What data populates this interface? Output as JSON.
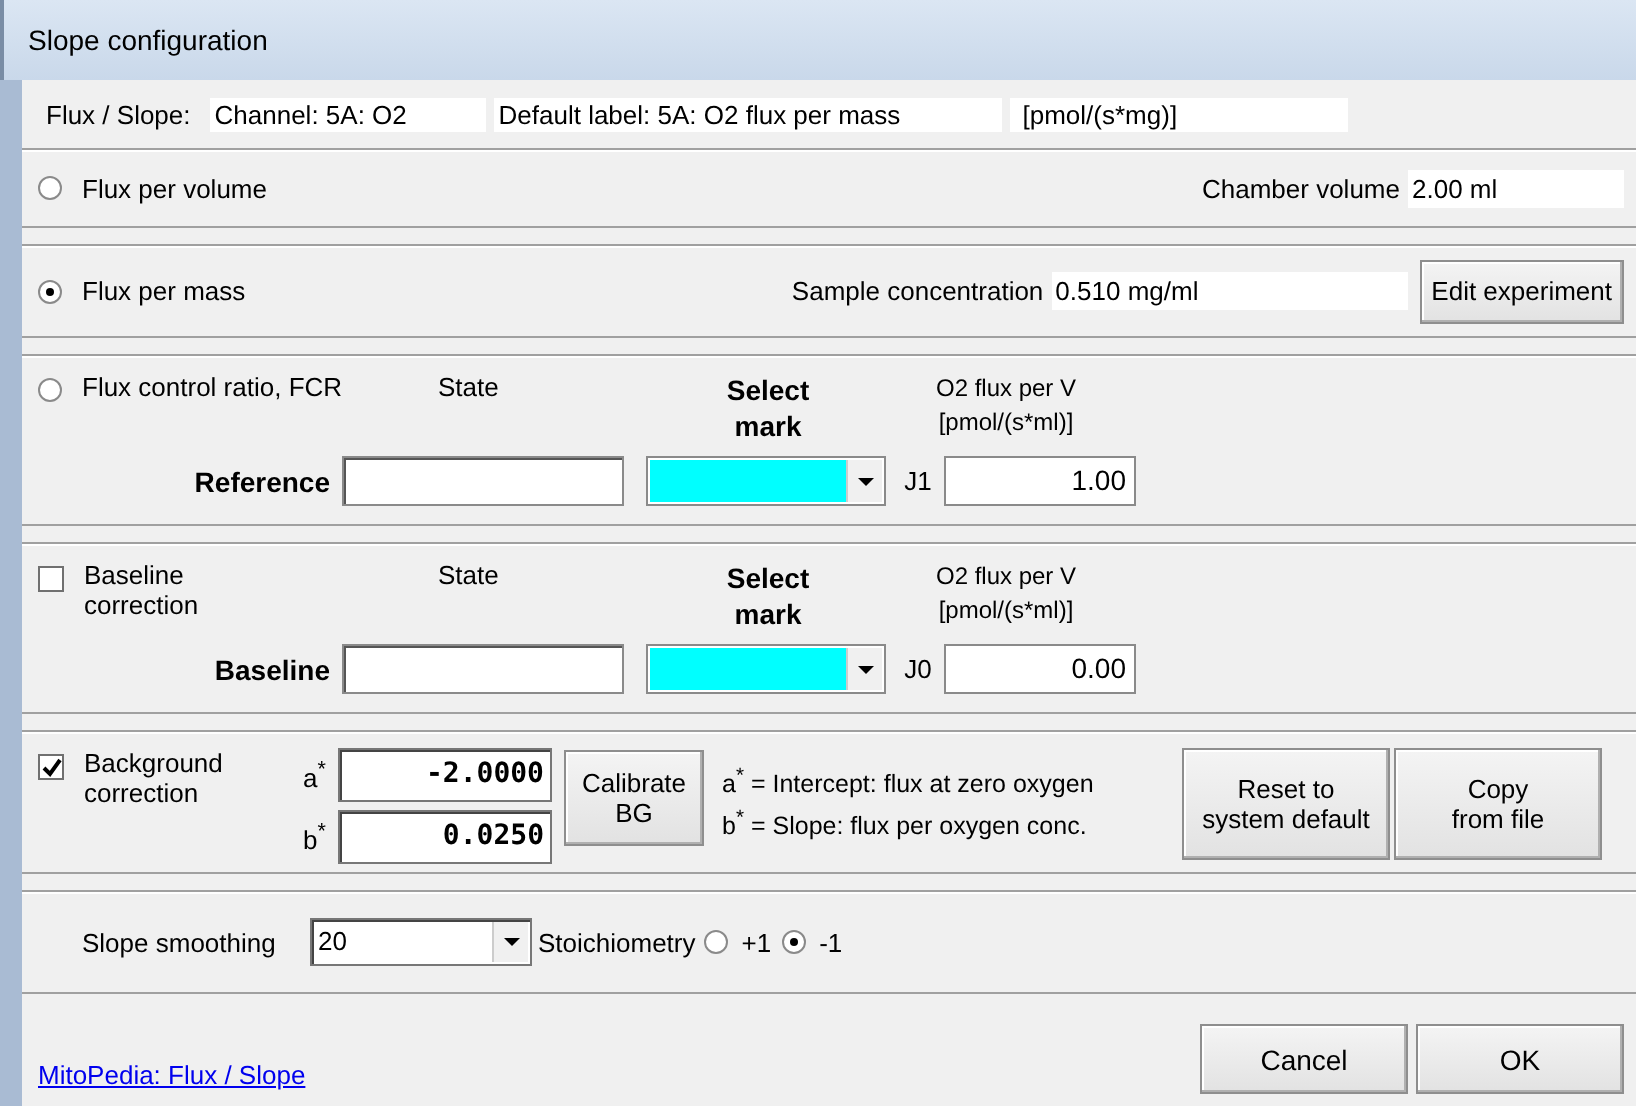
{
  "window": {
    "title": "Slope configuration"
  },
  "header": {
    "label": "Flux / Slope:",
    "channel": "Channel: 5A: O2",
    "default_label": "Default label: 5A: O2 flux per mass",
    "unit": "[pmol/(s*mg)]"
  },
  "flux_per_volume": {
    "label": "Flux per volume",
    "selected": false,
    "field_label": "Chamber volume",
    "value": "2.00 ml"
  },
  "flux_per_mass": {
    "label": "Flux per mass",
    "selected": true,
    "field_label": "Sample concentration",
    "value": "0.510 mg/ml",
    "button": "Edit experiment"
  },
  "fcr": {
    "label": "Flux control ratio, FCR",
    "selected": false,
    "state_heading": "State",
    "mark_heading": "Select mark",
    "flux_heading": "O2 flux per V [pmol/(s*ml)]",
    "row_label": "Reference",
    "j_label": "J1",
    "value": "1.00"
  },
  "baseline": {
    "label": "Baseline correction",
    "checked": false,
    "state_heading": "State",
    "mark_heading": "Select mark",
    "flux_heading": "O2 flux per V [pmol/(s*ml)]",
    "row_label": "Baseline",
    "j_label": "J0",
    "value": "0.00"
  },
  "background": {
    "label": "Background correction",
    "checked": true,
    "a_label": "a$^{*}$",
    "a_value": "-2.0000",
    "b_label": "b$^{*}$",
    "b_value": "0.0250",
    "calibrate_button": "Calibrate BG",
    "legend": [
      "a$^{*}$ = Intercept: flux at zero oxygen",
      "b$^{*}$ = Slope: flux per oxygen conc."
    ],
    "reset_button": "Reset to system default",
    "copy_button": "Copy from file"
  },
  "smoothing": {
    "label": "Slope smoothing",
    "value": "20",
    "stoichiometry_label": "Stoichiometry",
    "options": [
      {
        "label": "+1",
        "selected": false
      },
      {
        "label": "-1",
        "selected": true
      }
    ]
  },
  "footer": {
    "link": "MitoPedia: Flux / Slope",
    "buttons": [
      "Cancel",
      "OK"
    ]
  }
}
